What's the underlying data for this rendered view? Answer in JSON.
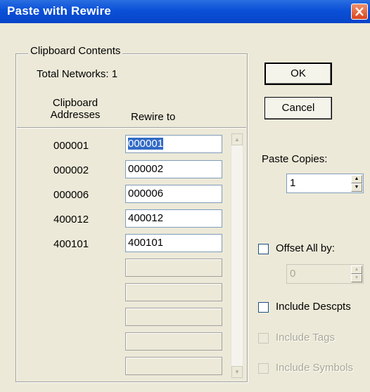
{
  "window": {
    "title": "Paste with Rewire"
  },
  "clipboard": {
    "legend": "Clipboard Contents",
    "total_networks": "Total Networks: 1",
    "col_addresses": "Clipboard\nAddresses",
    "col_rewire": "Rewire to",
    "rows": [
      {
        "address": "000001",
        "rewire": "000001"
      },
      {
        "address": "000002",
        "rewire": "000002"
      },
      {
        "address": "000006",
        "rewire": "000006"
      },
      {
        "address": "400012",
        "rewire": "400012"
      },
      {
        "address": "400101",
        "rewire": "400101"
      }
    ]
  },
  "buttons": {
    "ok": "OK",
    "cancel": "Cancel"
  },
  "paste_copies": {
    "label": "Paste Copies:",
    "value": "1"
  },
  "offset": {
    "label": "Offset All by:",
    "value": "0"
  },
  "include_descpts": {
    "label": "Include Descpts"
  },
  "include_tags": {
    "label": "Include Tags"
  },
  "include_symbols": {
    "label": "Include Symbols"
  }
}
